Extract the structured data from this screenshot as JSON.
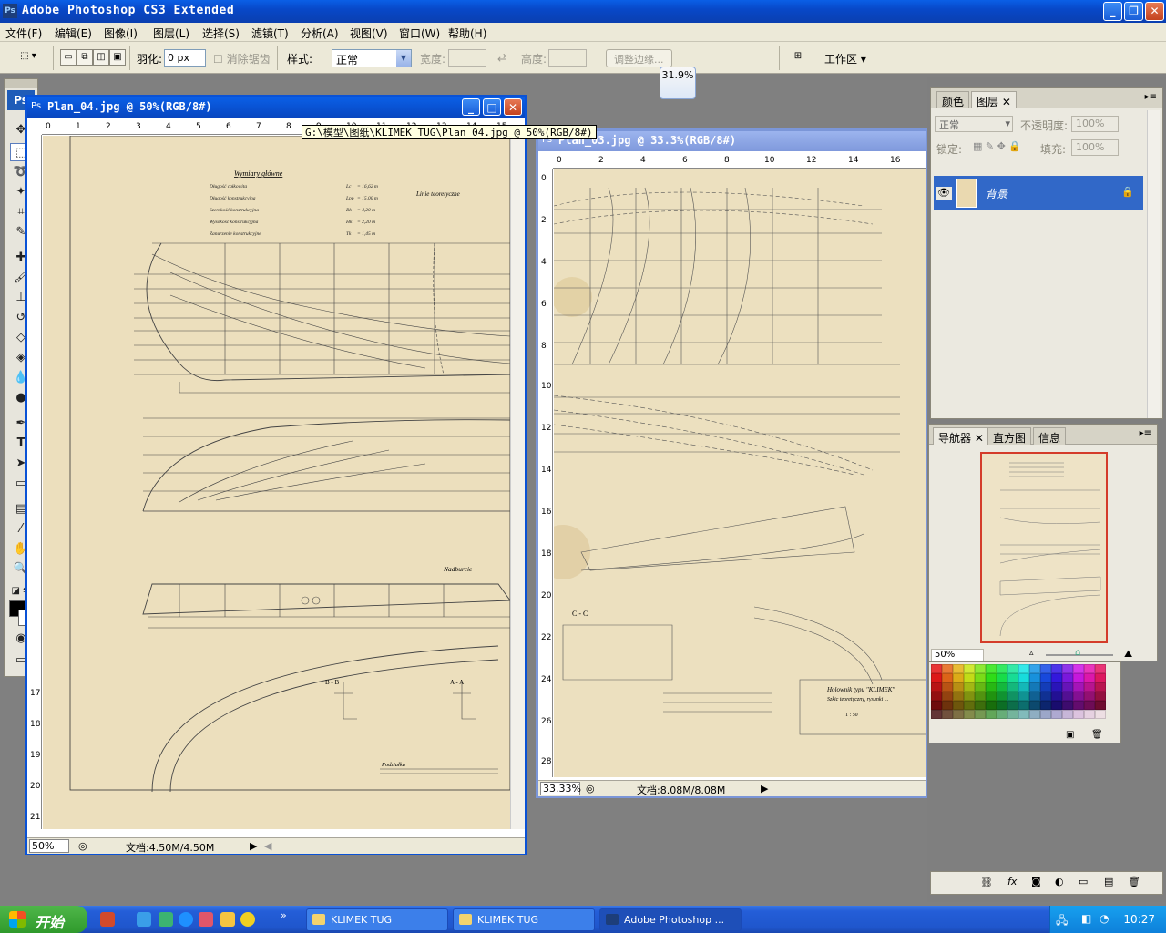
{
  "app": {
    "title": "Adobe Photoshop CS3 Extended",
    "logo": "Ps"
  },
  "menu": [
    "文件(F)",
    "编辑(E)",
    "图像(I)",
    "图层(L)",
    "选择(S)",
    "滤镜(T)",
    "分析(A)",
    "视图(V)",
    "窗口(W)",
    "帮助(H)"
  ],
  "options": {
    "feather_label": "羽化:",
    "feather_value": "0 px",
    "antialias_label": "消除锯齿",
    "style_label": "样式:",
    "style_value": "正常",
    "width_label": "宽度:",
    "height_label": "高度:",
    "refine_edge": "调整边缘...",
    "workspace": "工作区 ▾"
  },
  "zoom_popup": "31.9%",
  "tooltip": "G:\\模型\\图纸\\KLIMEK TUG\\Plan_04.jpg @ 50%(RGB/8#)",
  "doc1": {
    "title": "Plan_04.jpg @ 50%(RGB/8#)",
    "zoom": "50%",
    "docsize": "文档:4.50M/4.50M",
    "ruler_h": [
      "0",
      "1",
      "2",
      "3",
      "4",
      "5",
      "6",
      "7",
      "8",
      "9",
      "10",
      "11",
      "12",
      "13",
      "14",
      "15"
    ],
    "ruler_v": [
      "17",
      "18",
      "19",
      "20",
      "21"
    ],
    "drawing": {
      "heading": "Wymiary główne",
      "dims": [
        {
          "label": "Długość całkowita",
          "sym": "Lc",
          "val": "= 16,62 m"
        },
        {
          "label": "Długość konstrukcyjna",
          "sym": "Lpp",
          "val": "= 15,00 m"
        },
        {
          "label": "Szerokość konstrukcyjna",
          "sym": "Bk",
          "val": "= 4,20 m"
        },
        {
          "label": "Wysokość konstrukcyjna",
          "sym": "Hk",
          "val": "= 2,20 m"
        },
        {
          "label": "Zanurzenie konstrukcyjne",
          "sym": "Tk",
          "val": "= 1,45 m"
        }
      ],
      "lines_label": "Linie teoretyczne",
      "nadburcie": "Nadburcie",
      "section_bb": "B - B",
      "section_aa": "A - A",
      "podzialka": "Podziałka"
    }
  },
  "doc2": {
    "title": "Plan_03.jpg @ 33.3%(RGB/8#)",
    "zoom": "33.33%",
    "docsize": "文档:8.08M/8.08M",
    "ruler_h": [
      "0",
      "2",
      "4",
      "6",
      "8",
      "10",
      "12",
      "14",
      "16"
    ],
    "ruler_v": [
      "0",
      "2",
      "4",
      "6",
      "8",
      "10",
      "12",
      "14",
      "16",
      "18",
      "20",
      "22",
      "24",
      "26",
      "28"
    ],
    "drawing": {
      "section_cc": "C - C",
      "title_block": "Holownik typu \"KLIMEK\"",
      "subtitle": "Szkic teoretyczny, rysunki ...",
      "scale": "1 : 50"
    }
  },
  "layers_panel": {
    "tabs": [
      "颜色",
      "图层"
    ],
    "blend_mode": "正常",
    "opacity_label": "不透明度:",
    "opacity_value": "100%",
    "lock_label": "锁定:",
    "fill_label": "填充:",
    "fill_value": "100%",
    "layer_name": "背景"
  },
  "navigator_panel": {
    "tabs": [
      "导航器",
      "直方图",
      "信息"
    ],
    "zoom_value": "50%"
  },
  "taskbar": {
    "start": "开始",
    "tasks": [
      "KLIMEK TUG",
      "KLIMEK TUG",
      "Adobe Photoshop ..."
    ],
    "clock": "10:27"
  },
  "colors": {
    "xp_blue": "#0a52d6",
    "paper": "#e9dcb9",
    "selection": "#3168c8",
    "nav_frame": "#d43c2a"
  }
}
